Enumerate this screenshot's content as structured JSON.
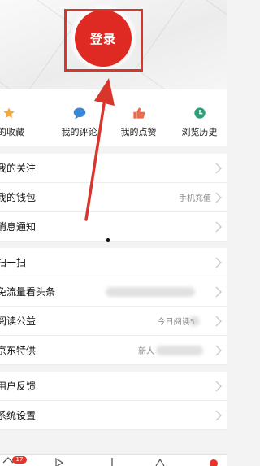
{
  "header": {
    "login_label": "登录"
  },
  "shortcuts": [
    {
      "label": "我的收藏",
      "icon": "star-icon",
      "color": "#f2a93b"
    },
    {
      "label": "我的评论",
      "icon": "comment-icon",
      "color": "#3a87d6"
    },
    {
      "label": "我的点赞",
      "icon": "thumbs-up-icon",
      "color": "#ea6a4a"
    },
    {
      "label": "浏览历史",
      "icon": "clock-icon",
      "color": "#2f9d78"
    }
  ],
  "menu": [
    {
      "title": "我的关注",
      "sub": ""
    },
    {
      "title": "我的钱包",
      "sub": "手机充值"
    },
    {
      "title": "消息通知",
      "sub": ""
    },
    {
      "title": "扫一扫",
      "sub": ""
    },
    {
      "title": "免流量看头条",
      "sub": ""
    },
    {
      "title": "阅读公益",
      "sub": "今日阅读5"
    },
    {
      "title": "京东特供",
      "sub": "新人"
    },
    {
      "title": "用户反馈",
      "sub": ""
    },
    {
      "title": "系统设置",
      "sub": ""
    }
  ],
  "tabbar": {
    "badge": "17"
  },
  "colors": {
    "accent": "#de2a22",
    "annotation": "#d8352c"
  }
}
